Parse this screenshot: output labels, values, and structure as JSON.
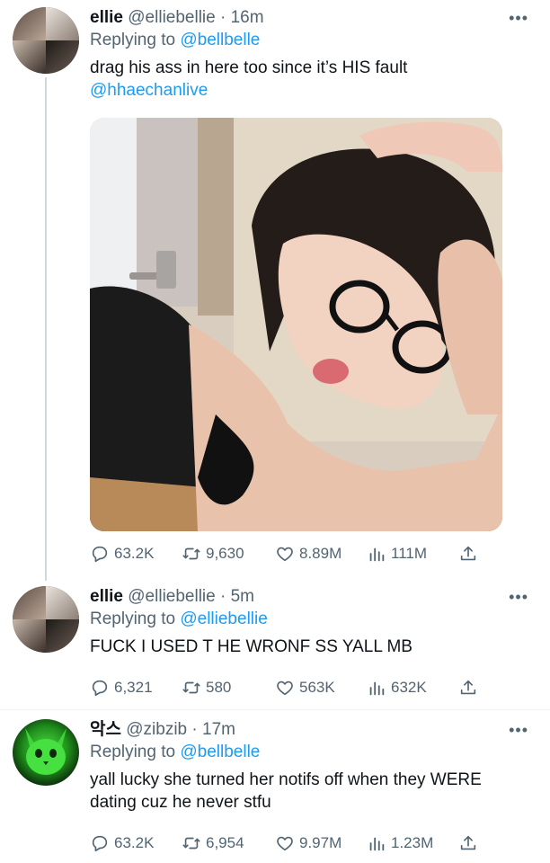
{
  "tweets": [
    {
      "name": "ellie",
      "handle": "@elliebellie",
      "time": "16m",
      "replying_label": "Replying to",
      "replying_handle": "@bellbelle",
      "text": "drag his ass in here too since it’s HIS fault",
      "mention": "@hhaechanlive",
      "stats": {
        "replies": "63.2K",
        "retweets": "9,630",
        "likes": "8.89M",
        "views": "111M"
      }
    },
    {
      "name": "ellie",
      "handle": "@elliebellie",
      "time": "5m",
      "replying_label": "Replying to",
      "replying_handle": "@elliebellie",
      "text": "FUCK I USED T HE WRONF SS YALL MB",
      "stats": {
        "replies": "6,321",
        "retweets": "580",
        "likes": "563K",
        "views": "632K"
      }
    },
    {
      "name": "악스",
      "handle": "@zibzib",
      "time": "17m",
      "replying_label": "Replying to",
      "replying_handle": "@bellbelle",
      "text": "yall lucky she turned her notifs off when they WERE dating cuz he never stfu",
      "stats": {
        "replies": "63.2K",
        "retweets": "6,954",
        "likes": "9.97M",
        "views": "1.23M"
      }
    }
  ],
  "separator": "·",
  "icons": {
    "more": "more-horizontal-icon",
    "reply": "reply-icon",
    "retweet": "retweet-icon",
    "like": "heart-icon",
    "views": "views-bar-chart-icon",
    "share": "share-icon"
  },
  "colors": {
    "link": "#1d9bf0",
    "secondary": "#536471",
    "text": "#0f1419"
  }
}
